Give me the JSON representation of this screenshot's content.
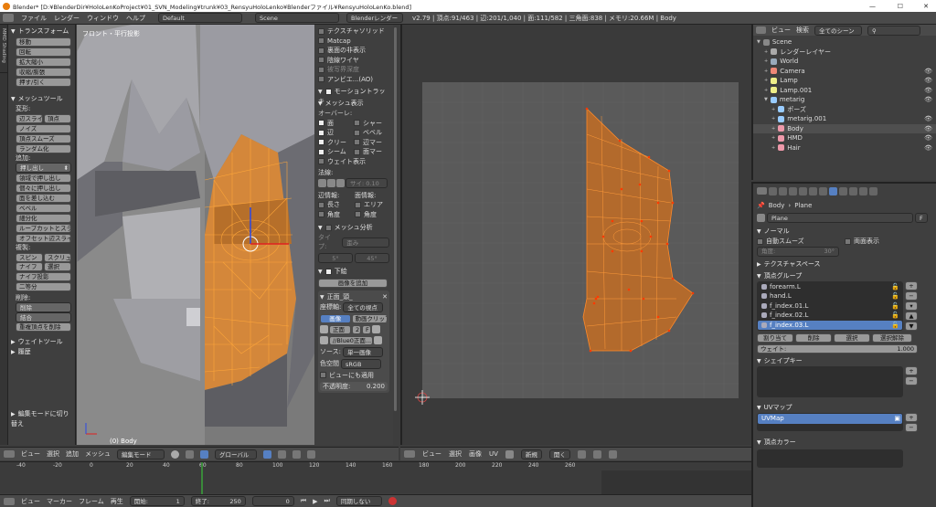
{
  "titlebar": {
    "title": "Blender* [D:¥BlenderDir¥HoloLenKoProject¥01_SVN_Modeling¥trunk¥03_RensyuHoloLenko¥Blenderファイル¥RensyuHoloLenKo.blend]",
    "minimize": "—",
    "maximize": "☐",
    "close": "✕"
  },
  "menubar": {
    "items": [
      "ファイル",
      "レンダー",
      "ウィンドウ",
      "ヘルプ"
    ],
    "layout": "Default",
    "scene": "Scene",
    "engine": "Blenderレンダー",
    "stats": "v2.79 | 頂点:91/463 | 辺:201/1,040 | 面:111/582 | 三角面:838 | メモリ:20.66M | Body"
  },
  "tools": {
    "transform_header": "トランスフォーム",
    "transform": [
      "移動",
      "回転",
      "拡大縮小",
      "収縮/膨張",
      "押す/引く"
    ],
    "meshtools_header": "メッシュツール",
    "deform_label": "変形:",
    "slide_edge": "辺スライ",
    "slide_vert": "頂点",
    "deform": [
      "ノイズ",
      "頂点スムーズ",
      "ランダム化"
    ],
    "add_label": "追加:",
    "extrude": "押し出し",
    "add": [
      "領域で押し出し",
      "個々に押し出し",
      "面を差し込む",
      "ベベル",
      "細分化",
      "ループカットとスライド",
      "オフセット辺スライド"
    ],
    "dup_label": "複製:",
    "spin": "スピン",
    "screw": "スクリュ",
    "knife": "ナイフ",
    "select": "選択",
    "dup": [
      "ナイフ投影",
      "二等分"
    ],
    "del_label": "削除:",
    "delete": "削除",
    "merge": "結合",
    "remove_doubles": "重複頂点を削除",
    "weight_header": "ウェイトツール",
    "history_header": "履歴",
    "toggle_editmode": "編集モードに切り替え",
    "vtabs": [
      "ツール",
      "作成",
      "関係",
      "アニメーション",
      "物理演算",
      "グリースペンシル",
      "HoloLenKo",
      "MMD",
      "MMD Shading"
    ]
  },
  "viewport3d": {
    "view_label": "フロント・平行投影",
    "obj_label": "(0) Body"
  },
  "props3d": {
    "shading": [
      "テクスチャソリッド",
      "Matcap",
      "裏面の非表示",
      "陰線ワイヤ",
      "被写界深度",
      "アンビエ...(AO)"
    ],
    "motion_tracking": "モーショントラッキ",
    "mesh_display": "メッシュ表示",
    "overlay": "オーバーレ:",
    "overlay_left": [
      "面",
      "辺",
      "クリー",
      "シーム"
    ],
    "overlay_right": [
      "シャー",
      "ベベル",
      "辺マー",
      "面マー"
    ],
    "weight": "ウェイト表示",
    "normals": "法線:",
    "normal_size": "サイ: 0.10",
    "edge_info": "辺情報:",
    "face_info": "面情報:",
    "info_l": [
      "長さ",
      "角度"
    ],
    "info_r": [
      "エリア",
      "角度"
    ],
    "mesh_analysis": "メッシュ分析",
    "type_label": "タイプ:",
    "type_val": "歪み",
    "min": "5°",
    "max": "45°",
    "bg_images": "下絵",
    "add_image": "画像を追加",
    "bg_item": "正面_頭_",
    "axis_label": "座標軸:",
    "axis_val": "全ての視点",
    "image_btn": "画像",
    "movie_btn": "動画クリップ",
    "front": "正面",
    "num2": "2",
    "F": "F",
    "file": "//Blue0正面...",
    "source_label": "ソース:",
    "source_val": "単一画像",
    "colorspace_label": "色空間",
    "colorspace_val": "sRGB",
    "view_as_render": "ビューにも適用",
    "opacity_label": "不透明度:",
    "opacity_val": "0.200"
  },
  "header3d": {
    "view": "ビュー",
    "select": "選択",
    "add": "追加",
    "mesh": "メッシュ",
    "mode": "編集モード",
    "orientation": "グローバル"
  },
  "uv": {
    "view": "ビュー",
    "select": "選択",
    "image": "画像",
    "uvs": "UV",
    "new": "新規",
    "open": "開く"
  },
  "outliner": {
    "view": "ビュー",
    "search": "検索",
    "scenes": "全てのシーン",
    "items": [
      {
        "label": "Scene",
        "level": 0
      },
      {
        "label": "レンダーレイヤー",
        "level": 1
      },
      {
        "label": "World",
        "level": 1
      },
      {
        "label": "Camera",
        "level": 1
      },
      {
        "label": "Lamp",
        "level": 1
      },
      {
        "label": "Lamp.001",
        "level": 1
      },
      {
        "label": "metarig",
        "level": 1
      },
      {
        "label": "ポーズ",
        "level": 2
      },
      {
        "label": "metarig.001",
        "level": 2
      },
      {
        "label": "Body",
        "level": 2
      },
      {
        "label": "HMD",
        "level": 2
      },
      {
        "label": "Hair",
        "level": 2
      }
    ]
  },
  "properties": {
    "body": "Body",
    "plane": "Plane",
    "plane_field": "Plane",
    "F": "F",
    "normals_header": "ノーマル",
    "autosmooth": "自動スムーズ",
    "double_sided": "両面表示",
    "angle": "角度:",
    "angle_val": "30°",
    "texspace": "テクスチャスペース",
    "vgroups_header": "頂点グループ",
    "vgroups": [
      "forearm.L",
      "hand.L",
      "f_index.01.L",
      "f_index.02.L",
      "f_index.03.L"
    ],
    "assign": "割り当て",
    "remove": "削除",
    "select": "選択",
    "deselect": "選択解除",
    "weight": "ウェイト:",
    "weight_val": "1.000",
    "shapekeys": "シェイプキー",
    "uvmaps": "UVマップ",
    "uvmap_item": "UVMap",
    "vcolors": "頂点カラー"
  },
  "timeline": {
    "ticks": [
      "-40",
      "-20",
      "0",
      "20",
      "40",
      "60",
      "80",
      "100",
      "120",
      "140",
      "160",
      "180",
      "200",
      "220",
      "240",
      "260"
    ],
    "view": "ビュー",
    "marker": "マーカー",
    "frame": "フレーム",
    "play": "再生",
    "start": "開始:",
    "start_val": "1",
    "end": "終了:",
    "end_val": "250",
    "current": "0",
    "sync": "同期しない"
  }
}
